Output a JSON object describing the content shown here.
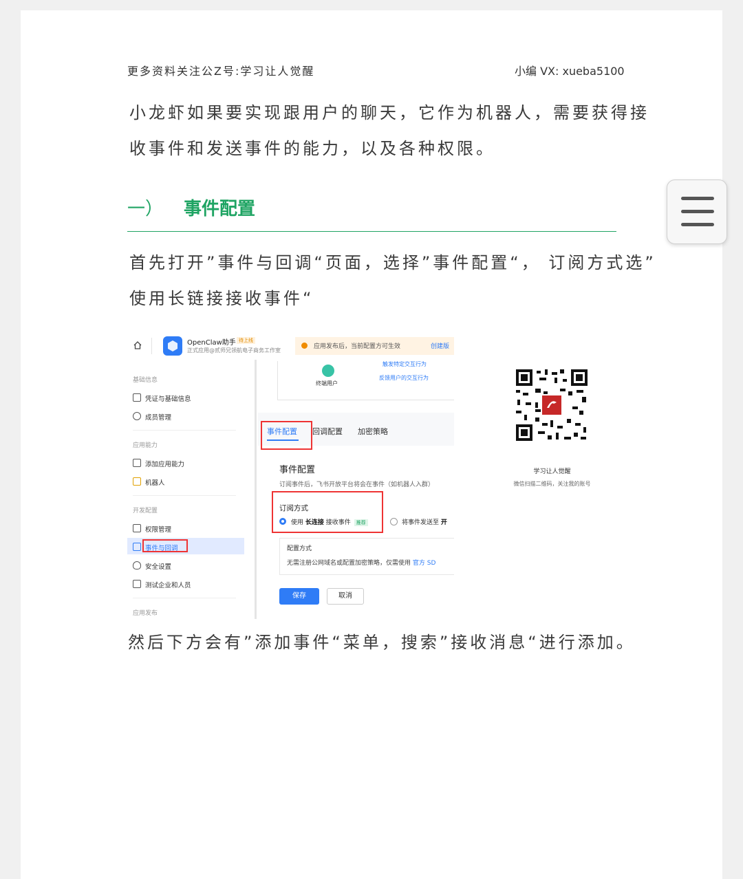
{
  "header": {
    "left": "更多资料关注公Z号:学习让人觉醒",
    "right": "小编 VX: xueba5100"
  },
  "intro": {
    "line1": "小龙虾如果要实现跟用户的聊天，它作为机器人，需要获得接",
    "line2": "收事件和发送事件的能力，以及各种权限。"
  },
  "section": {
    "number": "一）",
    "title": "事件配置"
  },
  "step": {
    "line1": "首先打开”事件与回调“页面，选择”事件配置“， 订阅方式选”",
    "line2": "使用长链接接收事件“"
  },
  "footer_text": "然后下方会有”添加事件“菜单，搜索”接收消息“进行添加。",
  "screenshot": {
    "app_name": "OpenClaw助手",
    "app_tag": "待上线",
    "app_sub": "正式应用@贰师兄领航电子商务工作室",
    "notice": "应用发布后，当前配置方可生效",
    "notice_link": "创建版",
    "diagram_user": "终端用户",
    "diagram_flow1": "触发特定交互行为",
    "diagram_flow2": "反馈用户的交互行为",
    "sidebar": {
      "group_basic": "基础信息",
      "item_cred": "凭证与基础信息",
      "item_members": "成员管理",
      "group_ability": "应用能力",
      "item_add_ability": "添加应用能力",
      "item_bot": "机器人",
      "group_dev": "开发配置",
      "item_perm": "权限管理",
      "item_events": "事件与回调",
      "item_security": "安全设置",
      "item_test": "测试企业和人员",
      "group_publish": "应用发布"
    },
    "tabs": [
      "事件配置",
      "回调配置",
      "加密策略"
    ],
    "event_title": "事件配置",
    "event_desc": "订阅事件后，飞书开放平台将会在事件（如机器人入群）",
    "sub_label": "订阅方式",
    "opt1_prefix": "使用",
    "opt1_bold": "长连接",
    "opt1_suffix": "接收事件",
    "opt1_tag": "推荐",
    "opt2_prefix": "将事件发送至",
    "opt2_bold": "开",
    "cfg_label": "配置方式",
    "cfg_desc": "无需注册公网域名或配置加密策略，仅需使用",
    "cfg_link": "官方 SD",
    "save": "保存",
    "cancel": "取消"
  },
  "qr": {
    "caption": "学习让人觉醒",
    "sub": "微信扫描二维码，关注我的账号"
  },
  "colors": {
    "accent_green": "#1fa463",
    "link_blue": "#2f7cf6",
    "highlight_red": "#e33333"
  }
}
